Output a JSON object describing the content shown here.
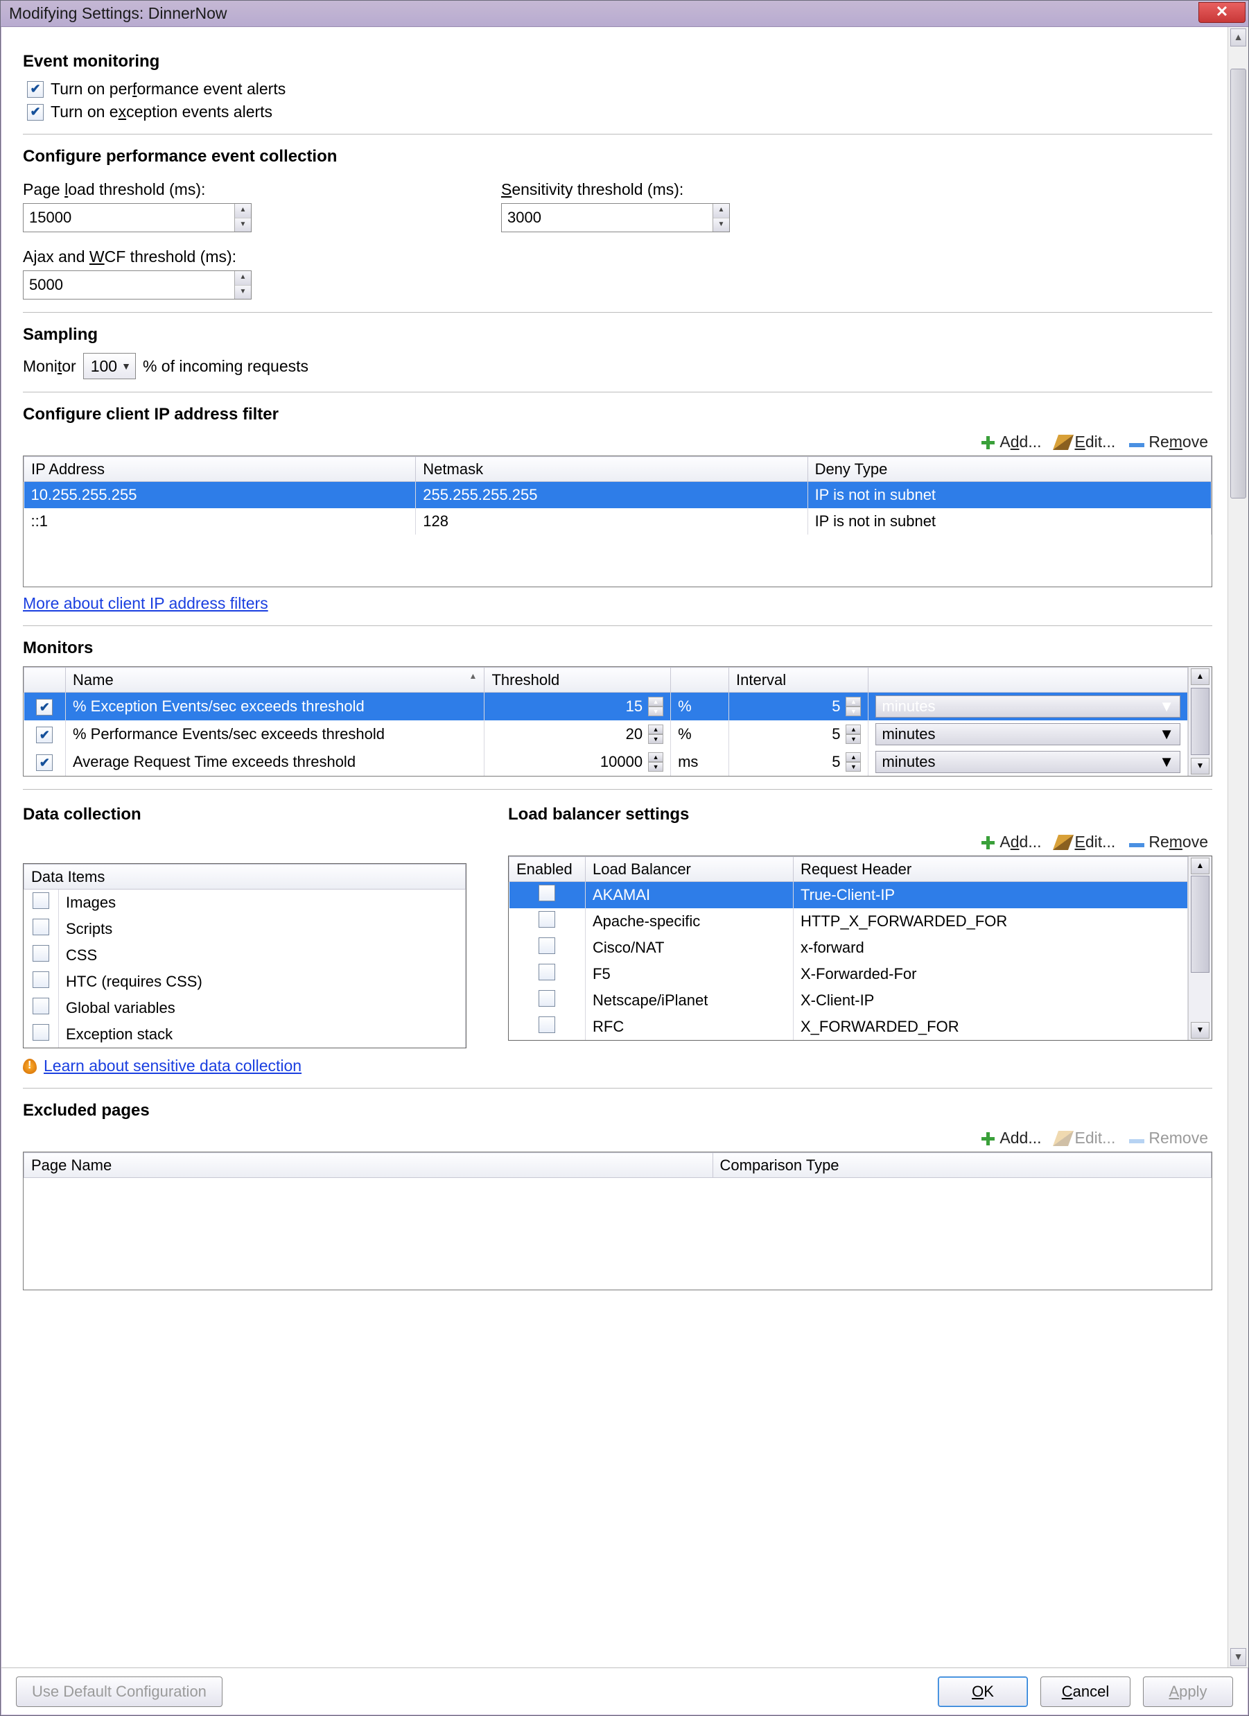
{
  "window": {
    "title": "Modifying Settings: DinnerNow"
  },
  "sections": {
    "eventMonitoring": {
      "heading": "Event monitoring",
      "perfAlerts": {
        "prefix": "Turn on per",
        "accel": "f",
        "suffix": "ormance event alerts",
        "checked": true
      },
      "excAlerts": {
        "prefix": "Turn on e",
        "accel": "x",
        "suffix": "ception events alerts",
        "checked": true
      }
    },
    "perfCollection": {
      "heading": "Configure performance event collection",
      "pageLoad": {
        "label_pre": "Page ",
        "label_accel": "l",
        "label_post": "oad threshold (ms):",
        "value": "15000"
      },
      "sensitivity": {
        "label_accel": "S",
        "label_post": "ensitivity threshold (ms):",
        "value": "3000"
      },
      "ajax": {
        "label_pre": "Ajax and ",
        "label_accel": "W",
        "label_post": "CF threshold (ms):",
        "value": "5000"
      }
    },
    "sampling": {
      "heading": "Sampling",
      "label_pre": "Moni",
      "label_accel": "t",
      "label_post": "or",
      "value": "100",
      "suffix": "% of incoming requests"
    },
    "ipFilter": {
      "heading": "Configure client IP address filter",
      "cols": {
        "ip": "IP Address",
        "netmask": "Netmask",
        "deny": "Deny Type"
      },
      "rows": [
        {
          "ip": "10.255.255.255",
          "netmask": "255.255.255.255",
          "deny": "IP is not in subnet",
          "selected": true
        },
        {
          "ip": "::1",
          "netmask": "128",
          "deny": "IP is not in subnet"
        }
      ],
      "link": "More about client IP address filters"
    },
    "monitors": {
      "heading": "Monitors",
      "cols": {
        "name": "Name",
        "threshold": "Threshold",
        "interval": "Interval"
      },
      "rows": [
        {
          "checked": true,
          "name": "% Exception Events/sec exceeds threshold",
          "threshold": "15",
          "tunit": "%",
          "interval": "5",
          "iunit": "minutes",
          "selected": true
        },
        {
          "checked": true,
          "name": "% Performance Events/sec exceeds threshold",
          "threshold": "20",
          "tunit": "%",
          "interval": "5",
          "iunit": "minutes"
        },
        {
          "checked": true,
          "name": "Average Request Time exceeds threshold",
          "threshold": "10000",
          "tunit": "ms",
          "interval": "5",
          "iunit": "minutes"
        }
      ]
    },
    "dataCollection": {
      "heading": "Data collection",
      "col": "Data Items",
      "items": [
        "Images",
        "Scripts",
        "CSS",
        "HTC (requires CSS)",
        "Global variables",
        "Exception stack"
      ],
      "link": "Learn about sensitive data collection"
    },
    "loadBalancer": {
      "heading": "Load balancer settings",
      "cols": {
        "enabled": "Enabled",
        "lb": "Load Balancer",
        "hdr": "Request Header"
      },
      "rows": [
        {
          "enabled": false,
          "lb": "AKAMAI",
          "hdr": "True-Client-IP",
          "selected": true
        },
        {
          "enabled": false,
          "lb": "Apache-specific",
          "hdr": "HTTP_X_FORWARDED_FOR"
        },
        {
          "enabled": false,
          "lb": "Cisco/NAT",
          "hdr": "x-forward"
        },
        {
          "enabled": false,
          "lb": "F5",
          "hdr": "X-Forwarded-For"
        },
        {
          "enabled": false,
          "lb": "Netscape/iPlanet",
          "hdr": "X-Client-IP"
        },
        {
          "enabled": false,
          "lb": "RFC",
          "hdr": "X_FORWARDED_FOR"
        }
      ]
    },
    "excluded": {
      "heading": "Excluded pages",
      "cols": {
        "page": "Page Name",
        "cmp": "Comparison Type"
      }
    }
  },
  "toolbar": {
    "add_pre": "A",
    "add_accel": "d",
    "add_post": "d...",
    "edit_accel": "E",
    "edit_post": "dit...",
    "remove_pre": "Re",
    "remove_accel": "m",
    "remove_post": "ove",
    "add2": "Add...",
    "edit2": "Edit...",
    "remove2": "Remove"
  },
  "footer": {
    "defaultCfg": "Use Default Configuration",
    "ok_accel": "O",
    "ok_post": "K",
    "cancel_accel": "C",
    "cancel_post": "ancel",
    "apply_accel": "A",
    "apply_post": "pply"
  }
}
